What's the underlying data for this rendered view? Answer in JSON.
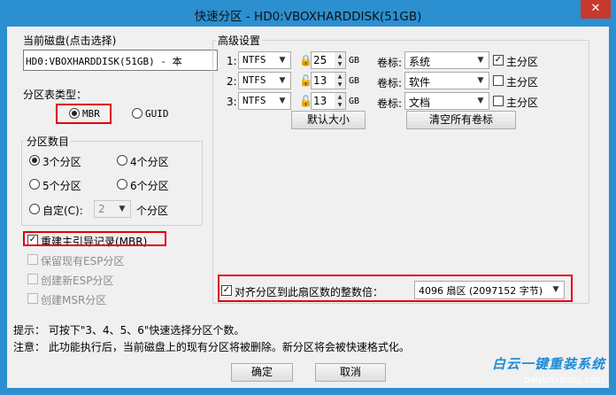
{
  "window": {
    "title": "快速分区 - HD0:VBOXHARDDISK(51GB)",
    "close_glyph": "✕"
  },
  "disk": {
    "label": "当前磁盘(点击选择)",
    "value": "HD0:VBOXHARDDISK(51GB) - 本"
  },
  "table_type": {
    "label": "分区表类型：",
    "options": [
      "MBR",
      "GUID"
    ],
    "selected": "MBR"
  },
  "partition_count": {
    "label": "分区数目",
    "options": [
      "3个分区",
      "4个分区",
      "5个分区",
      "6个分区"
    ],
    "selected": "3个分区",
    "custom_label": "自定(C):",
    "custom_value": "2",
    "custom_suffix": "个分区"
  },
  "options": {
    "rebuild_mbr": "重建主引导记录(MBR)",
    "keep_esp": "保留现有ESP分区",
    "create_esp": "创建新ESP分区",
    "create_msr": "创建MSR分区"
  },
  "advanced": {
    "label": "高级设置",
    "unit": "GB",
    "volume_label": "卷标:",
    "primary_label": "主分区",
    "partitions": [
      {
        "index": "1:",
        "fs": "NTFS",
        "size": "25",
        "volume": "系统",
        "primary": true,
        "locked": true
      },
      {
        "index": "2:",
        "fs": "NTFS",
        "size": "13",
        "volume": "软件",
        "primary": false,
        "locked": false
      },
      {
        "index": "3:",
        "fs": "NTFS",
        "size": "13",
        "volume": "文档",
        "primary": false,
        "locked": false
      }
    ],
    "default_size_button": "默认大小",
    "clear_labels_button": "清空所有卷标"
  },
  "align": {
    "label": "对齐分区到此扇区数的整数倍：",
    "value": "4096 扇区 (2097152 字节)",
    "checked": true
  },
  "tips": {
    "line1": "提示：  可按下\"3、4、5、6\"快速选择分区个数。",
    "line2": "注意：  此功能执行后，当前磁盘上的现有分区将被删除。新分区将会被快速格式化。"
  },
  "buttons": {
    "ok": "确定",
    "cancel": "取消"
  },
  "watermark": {
    "name": "白云一键重装系统",
    "url": "baiyunxitong.com"
  },
  "colors": {
    "frame": "#2b8fd0",
    "close": "#c7392d",
    "highlight": "#e0000f",
    "watermark": "#1f8bd6"
  }
}
